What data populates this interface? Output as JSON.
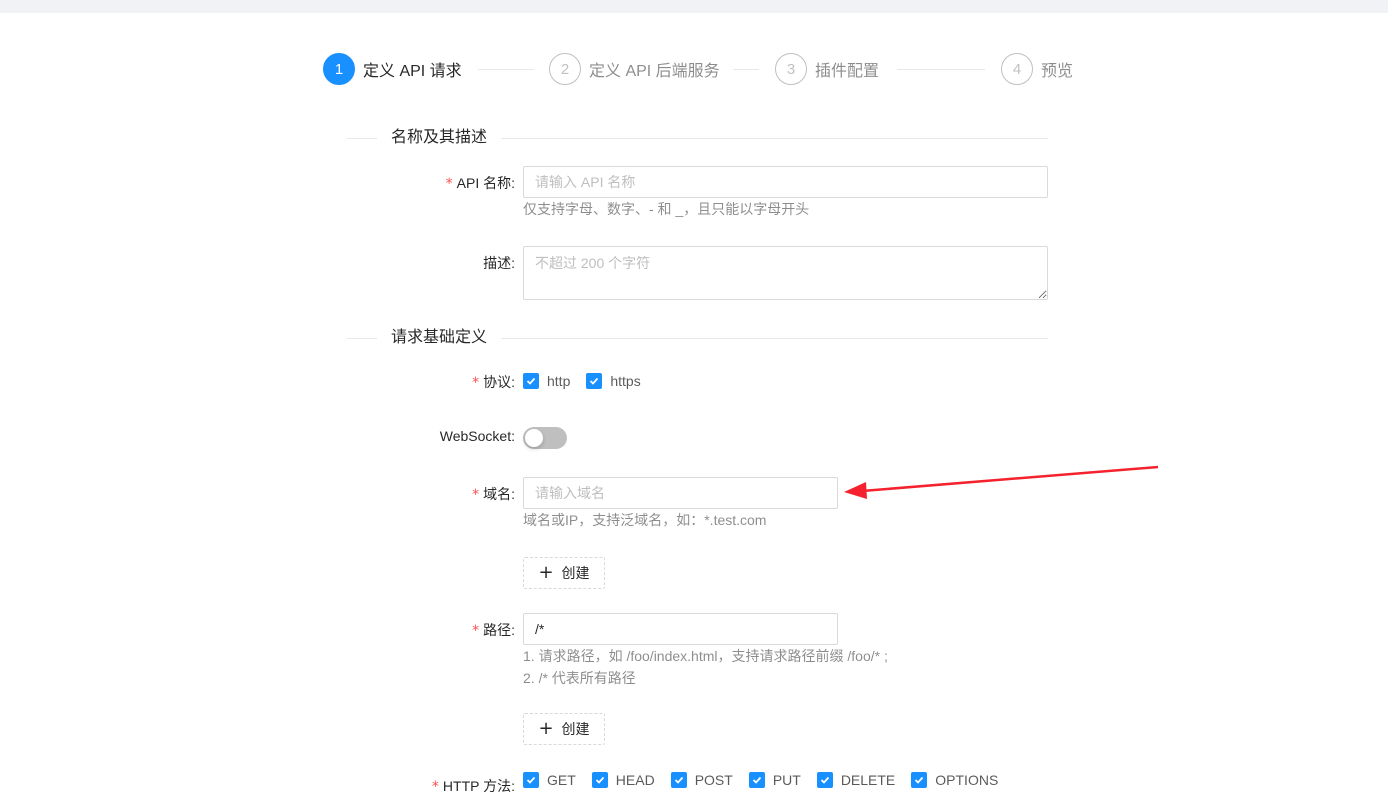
{
  "steps": [
    {
      "num": "1",
      "title": "定义 API 请求"
    },
    {
      "num": "2",
      "title": "定义 API 后端服务"
    },
    {
      "num": "3",
      "title": "插件配置"
    },
    {
      "num": "4",
      "title": "预览"
    }
  ],
  "section_name": "名称及其描述",
  "section_basic": "请求基础定义",
  "api_name": {
    "label": "API 名称:",
    "placeholder": "请输入 API 名称",
    "help": "仅支持字母、数字、- 和 _，且只能以字母开头"
  },
  "description": {
    "label": "描述:",
    "placeholder": "不超过 200 个字符"
  },
  "protocol": {
    "label": "协议:",
    "options": [
      "http",
      "https"
    ]
  },
  "websocket": {
    "label": "WebSocket:",
    "enabled": false
  },
  "domain": {
    "label": "域名:",
    "placeholder": "请输入域名",
    "help": "域名或IP，支持泛域名，如：*.test.com",
    "create_label": "创建"
  },
  "path": {
    "label": "路径:",
    "value": "/*",
    "help1": "1. 请求路径，如 /foo/index.html，支持请求路径前缀 /foo/* ;",
    "help2": "2. /* 代表所有路径",
    "create_label": "创建"
  },
  "http_method": {
    "label": "HTTP 方法:",
    "options": [
      "GET",
      "HEAD",
      "POST",
      "PUT",
      "DELETE",
      "OPTIONS"
    ]
  },
  "colors": {
    "primary": "#1890ff",
    "required": "#ff4d4f",
    "arrow": "#f5222d"
  }
}
